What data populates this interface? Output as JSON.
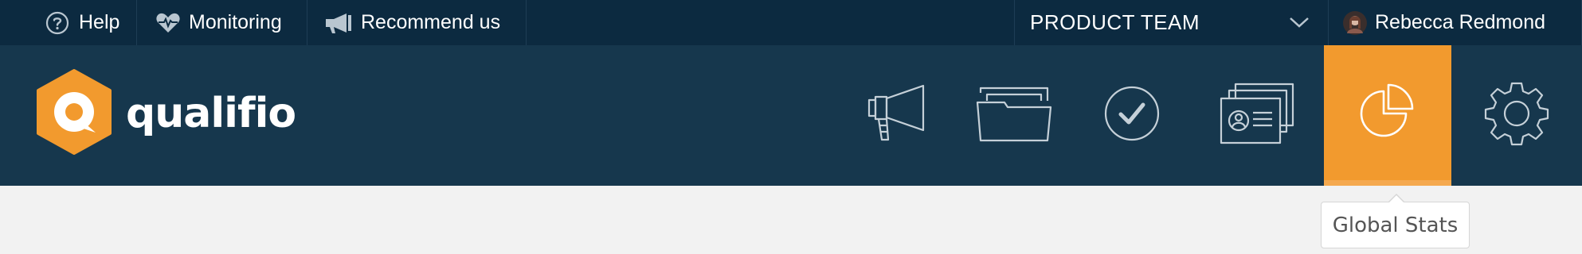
{
  "topbar": {
    "help_label": "Help",
    "monitoring_label": "Monitoring",
    "recommend_label": "Recommend us",
    "team_label": "PRODUCT TEAM",
    "user_name": "Rebecca Redmond"
  },
  "brand": {
    "name": "qualifio",
    "logo_color": "#f29a2e"
  },
  "nav": {
    "items": [
      {
        "icon": "megaphone-icon",
        "active": false
      },
      {
        "icon": "folder-icon",
        "active": false
      },
      {
        "icon": "check-circle-icon",
        "active": false
      },
      {
        "icon": "contact-cards-icon",
        "active": false
      },
      {
        "icon": "pie-chart-icon",
        "active": true
      },
      {
        "icon": "gear-icon",
        "active": false
      }
    ]
  },
  "tooltip": {
    "text": "Global Stats"
  },
  "colors": {
    "topbar": "#0c2a40",
    "navbar": "#16374d",
    "accent": "#f29a2e",
    "icon_stroke": "#c5d0d8",
    "background": "#f2f2f2"
  }
}
